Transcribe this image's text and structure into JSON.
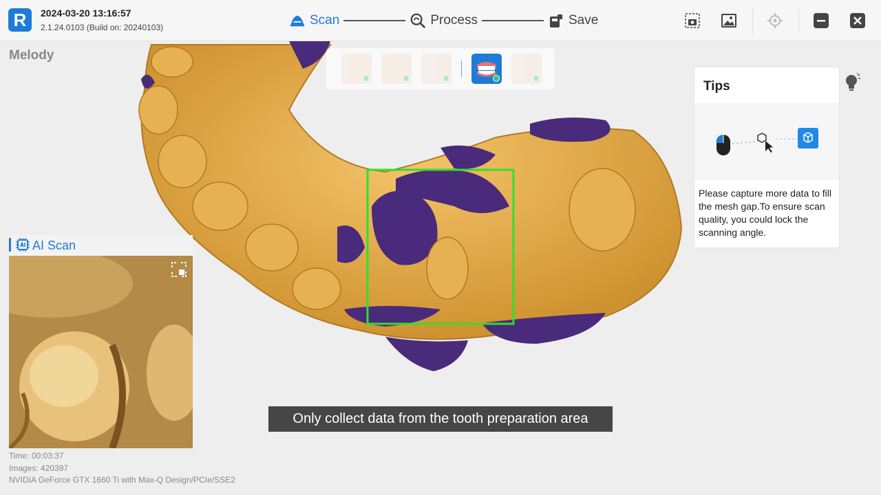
{
  "header": {
    "logo_letter": "R",
    "datetime": "2024-03-20 13:16:57",
    "version": "2.1.24.0103 (Build on: 20240103)",
    "steps": [
      {
        "label": "Scan",
        "active": true
      },
      {
        "label": "Process",
        "active": false
      },
      {
        "label": "Save",
        "active": false
      }
    ],
    "accent_color": "#1f7bd8"
  },
  "patient_name": "Melody",
  "tips": {
    "title": "Tips",
    "text": "Please capture more data to fill the mesh gap.To ensure scan quality, you could lock the scanning angle."
  },
  "ai_scan": {
    "title": "AI Scan"
  },
  "status": {
    "time": "Time: 00:03:37",
    "images": "Images: 420397",
    "gpu": "NVIDIA GeForce GTX 1660 Ti with Max-Q Design/PCIe/SSE2"
  },
  "caption": "Only collect data from the tooth preparation area",
  "colors": {
    "model": "#e0a83a",
    "gap": "#4a2a7a",
    "focus_box": "#2ee02e"
  }
}
